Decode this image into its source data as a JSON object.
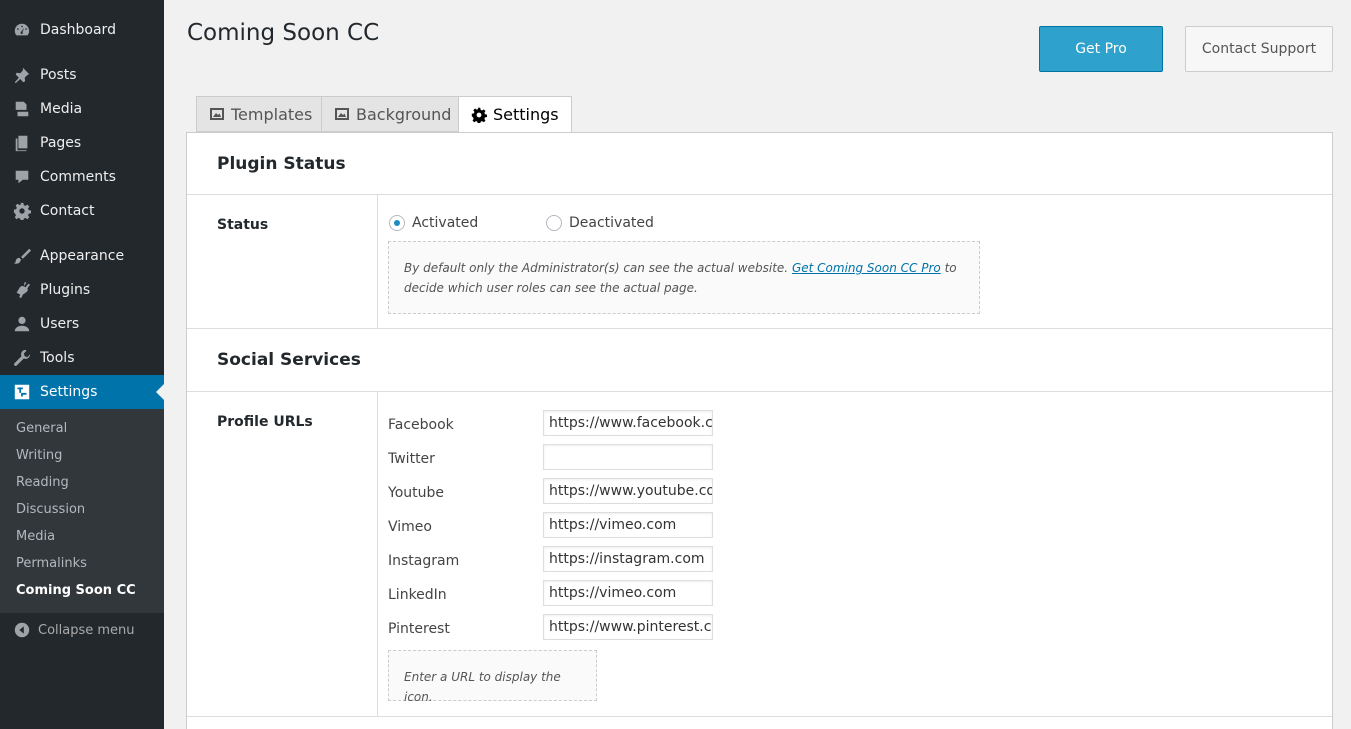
{
  "sidebar": {
    "items": [
      {
        "label": "Dashboard",
        "icon": "dashboard-icon"
      },
      {
        "label": "Posts",
        "icon": "pin-icon"
      },
      {
        "label": "Media",
        "icon": "media-icon"
      },
      {
        "label": "Pages",
        "icon": "pages-icon"
      },
      {
        "label": "Comments",
        "icon": "comment-icon"
      },
      {
        "label": "Contact",
        "icon": "gear-icon"
      },
      {
        "label": "Appearance",
        "icon": "brush-icon"
      },
      {
        "label": "Plugins",
        "icon": "plug-icon"
      },
      {
        "label": "Users",
        "icon": "user-icon"
      },
      {
        "label": "Tools",
        "icon": "wrench-icon"
      },
      {
        "label": "Settings",
        "icon": "settings-icon"
      }
    ],
    "submenu": [
      "General",
      "Writing",
      "Reading",
      "Discussion",
      "Media",
      "Permalinks",
      "Coming Soon CC"
    ],
    "collapse_label": "Collapse menu"
  },
  "header": {
    "title": "Coming Soon CC",
    "getpro_label": "Get Pro",
    "support_label": "Contact Support"
  },
  "tabs": [
    {
      "label": "Templates",
      "icon": "image-icon"
    },
    {
      "label": "Background",
      "icon": "image-icon"
    },
    {
      "label": "Settings",
      "icon": "gear-icon"
    }
  ],
  "plugin_status": {
    "heading": "Plugin Status",
    "label": "Status",
    "options": [
      "Activated",
      "Deactivated"
    ],
    "selected": "Activated",
    "note_before": "By default only the Administrator(s) can see the actual website.",
    "note_link": "Get Coming Soon CC Pro",
    "note_after": "to decide which user roles can see the actual page."
  },
  "social": {
    "heading": "Social Services",
    "label": "Profile URLs",
    "fields": [
      {
        "name": "Facebook",
        "value": "https://www.facebook.com"
      },
      {
        "name": "Twitter",
        "value": ""
      },
      {
        "name": "Youtube",
        "value": "https://www.youtube.com"
      },
      {
        "name": "Vimeo",
        "value": "https://vimeo.com"
      },
      {
        "name": "Instagram",
        "value": "https://instagram.com"
      },
      {
        "name": "LinkedIn",
        "value": "https://vimeo.com"
      },
      {
        "name": "Pinterest",
        "value": "https://www.pinterest.com"
      }
    ],
    "hint": "Enter a URL to display the icon."
  },
  "colors": {
    "sidebar_bg": "#23282d",
    "active_menu": "#0073aa",
    "primary_button": "#2ea2cc"
  }
}
